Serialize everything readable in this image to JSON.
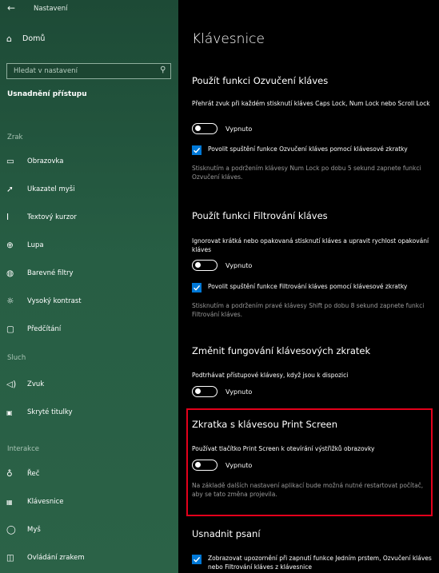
{
  "window": {
    "title": "Nastavení"
  },
  "sidebar": {
    "home": "Domů",
    "search_placeholder": "Hledat v nastavení",
    "section_title": "Usnadnění přístupu",
    "categories": {
      "vision": "Zrak",
      "hearing": "Sluch",
      "interaction": "Interakce"
    },
    "items": [
      {
        "label": "Obrazovka",
        "icon": "monitor-icon"
      },
      {
        "label": "Ukazatel myši",
        "icon": "mouse-pointer-icon"
      },
      {
        "label": "Textový kurzor",
        "icon": "text-cursor-icon"
      },
      {
        "label": "Lupa",
        "icon": "magnifier-icon"
      },
      {
        "label": "Barevné filtry",
        "icon": "color-filter-icon"
      },
      {
        "label": "Vysoký kontrast",
        "icon": "high-contrast-icon"
      },
      {
        "label": "Předčítání",
        "icon": "narrator-icon"
      },
      {
        "label": "Zvuk",
        "icon": "speaker-icon"
      },
      {
        "label": "Skryté titulky",
        "icon": "closed-captions-icon"
      },
      {
        "label": "Řeč",
        "icon": "microphone-icon"
      },
      {
        "label": "Klávesnice",
        "icon": "keyboard-icon"
      },
      {
        "label": "Myš",
        "icon": "mouse-icon"
      },
      {
        "label": "Ovládání zrakem",
        "icon": "eye-control-icon"
      }
    ]
  },
  "main": {
    "title": "Klávesnice",
    "toggle_sounds": {
      "heading": "Použít funkci Ozvučení kláves",
      "description": "Přehrát zvuk při každém stisknutí kláves Caps Lock, Num Lock nebo Scroll Lock",
      "toggle_label": "Vypnuto",
      "checkbox_label": "Povolit spuštění funkce Ozvučení kláves pomocí klávesové zkratky",
      "note": "Stisknutím a podržením klávesy Num Lock po dobu 5 sekund zapnete funkci Ozvučení kláves."
    },
    "filter_keys": {
      "heading": "Použít funkci Filtrování kláves",
      "description": "Ignorovat krátká nebo opakovaná stisknutí kláves a upravit rychlost opakování kláves",
      "toggle_label": "Vypnuto",
      "checkbox_label": "Povolit spuštění funkce Filtrování kláves pomocí klávesové zkratky",
      "note": "Stisknutím a podržením pravé klávesy Shift po dobu 8 sekund zapnete funkci Filtrování kláves."
    },
    "shortcuts": {
      "heading": "Změnit fungování klávesových zkratek",
      "description": "Podtrhávat přístupové klávesy, když jsou k dispozici",
      "toggle_label": "Vypnuto"
    },
    "print_screen": {
      "heading": "Zkratka s klávesou Print Screen",
      "description": "Používat tlačítko Print Screen k otevírání výstřižků obrazovky",
      "toggle_label": "Vypnuto",
      "note": "Na základě dalších nastavení aplikací bude možná nutné restartovat počítač, aby se tato změna projevila."
    },
    "typing": {
      "heading": "Usnadnit psaní",
      "checkbox_label": "Zobrazovat upozornění při zapnutí funkce Jedním prstem, Ozvučení kláves nebo Filtrování kláves z klávesnice"
    }
  },
  "colors": {
    "accent": "#0078d7",
    "highlight": "#e3001b",
    "sidebar": "#275e44"
  }
}
